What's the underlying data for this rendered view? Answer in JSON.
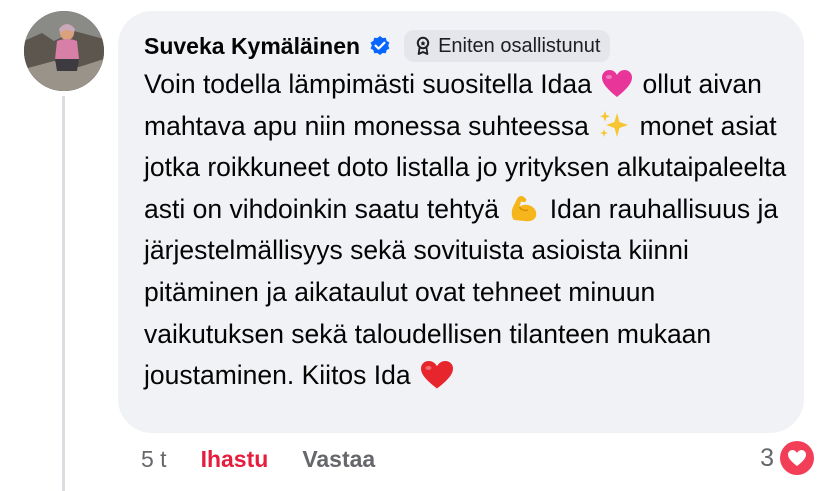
{
  "comment": {
    "author": "Suveka Kymäläinen",
    "badge_label": "Eniten osallistunut",
    "badge_icon": "top-contributor-icon",
    "verified_icon": "verified-icon",
    "text": {
      "part1": "Voin todella lämpimästi suositella Idaa ",
      "emoji1": "pink-heart-emoji",
      "part2": " ollut aivan mahtava apu niin monessa suhteessa ",
      "emoji2": "sparkles-emoji",
      "part3": " monet asiat jotka roikkuneet doto listalla jo yrityksen alkutaipaleelta asti on vihdoinkin saatu tehtyä ",
      "emoji3": "flexed-biceps-emoji",
      "part4": " Idan rauhallisuus ja järjestelmällisyys sekä sovituista asioista kiinni pitäminen ja aikataulut ovat tehneet minuun vaikutuksen sekä taloudellisen tilanteen mukaan joustaminen. Kiitos Ida ",
      "emoji4": "red-heart-emoji"
    }
  },
  "actions": {
    "time": "5 t",
    "like_label": "Ihastu",
    "reply_label": "Vastaa"
  },
  "reactions": {
    "count": "3",
    "icon": "heart-reaction-icon"
  },
  "colors": {
    "bubble": "#f0f2f5",
    "liked": "#e41e3f",
    "verified": "#0866ff",
    "heart_reaction": "#f33e58"
  }
}
